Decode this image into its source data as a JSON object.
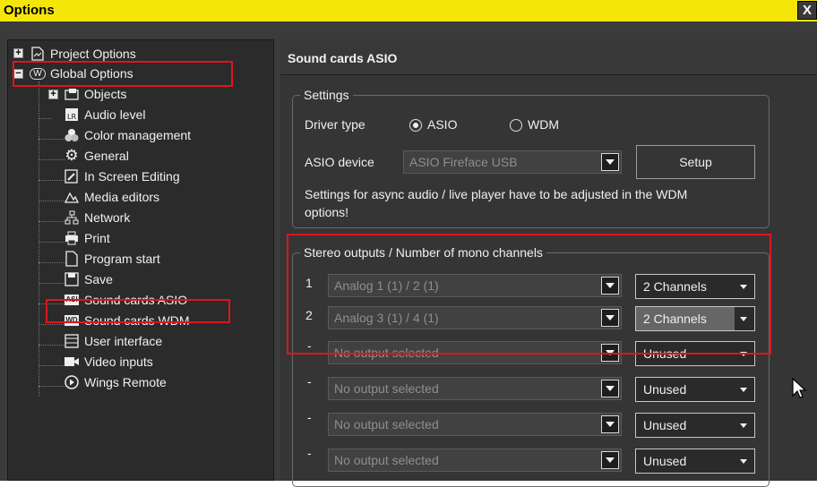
{
  "window": {
    "title": "Options",
    "close_label": "X"
  },
  "tree": {
    "items": [
      {
        "label": "Project Options",
        "icon": "project-options-icon"
      },
      {
        "label": "Global Options",
        "icon": "global-options-icon"
      },
      {
        "label": "Objects",
        "icon": "objects-icon"
      },
      {
        "label": "Audio level",
        "icon": "audio-level-icon"
      },
      {
        "label": "Color management",
        "icon": "color-management-icon"
      },
      {
        "label": "General",
        "icon": "gear-icon"
      },
      {
        "label": "In Screen Editing",
        "icon": "in-screen-editing-icon"
      },
      {
        "label": "Media editors",
        "icon": "media-editors-icon"
      },
      {
        "label": "Network",
        "icon": "network-icon"
      },
      {
        "label": "Print",
        "icon": "printer-icon"
      },
      {
        "label": "Program start",
        "icon": "program-start-icon"
      },
      {
        "label": "Save",
        "icon": "save-icon"
      },
      {
        "label": "Sound cards ASIO",
        "icon": "sound-card-asio-icon",
        "icon_text": "ASI"
      },
      {
        "label": "Sound cards WDM",
        "icon": "sound-card-wdm-icon",
        "icon_text": "WD"
      },
      {
        "label": "User interface",
        "icon": "user-interface-icon"
      },
      {
        "label": "Video inputs",
        "icon": "video-camera-icon"
      },
      {
        "label": "Wings Remote",
        "icon": "play-circle-icon"
      }
    ],
    "expander_plus": "+",
    "expander_minus": "−",
    "global_icon_text": "W"
  },
  "panel": {
    "title": "Sound cards ASIO",
    "settings": {
      "legend": "Settings",
      "driver_type_label": "Driver type",
      "driver_options": [
        "ASIO",
        "WDM"
      ],
      "driver_selected": "ASIO",
      "asio_device_label": "ASIO device",
      "asio_device_value": "ASIO Fireface USB",
      "setup_button": "Setup",
      "note_line1": "Settings for async audio / live player have to be adjusted in the WDM",
      "note_line2": "options!"
    },
    "stereo": {
      "legend": "Stereo outputs / Number of mono channels",
      "rows": [
        {
          "num": "1",
          "output": "Analog 1 (1) / 2 (1)",
          "channels": "2 Channels"
        },
        {
          "num": "2",
          "output": "Analog 3 (1) / 4 (1)",
          "channels": "2 Channels"
        },
        {
          "num": "-",
          "output": "No output selected",
          "channels": "Unused"
        },
        {
          "num": "-",
          "output": "No output selected",
          "channels": "Unused"
        },
        {
          "num": "-",
          "output": "No output selected",
          "channels": "Unused"
        },
        {
          "num": "-",
          "output": "No output selected",
          "channels": "Unused"
        }
      ]
    }
  },
  "colors": {
    "title_bar": "#f5e60a",
    "highlight_box": "#e0141e",
    "panel_bg": "#353535"
  }
}
